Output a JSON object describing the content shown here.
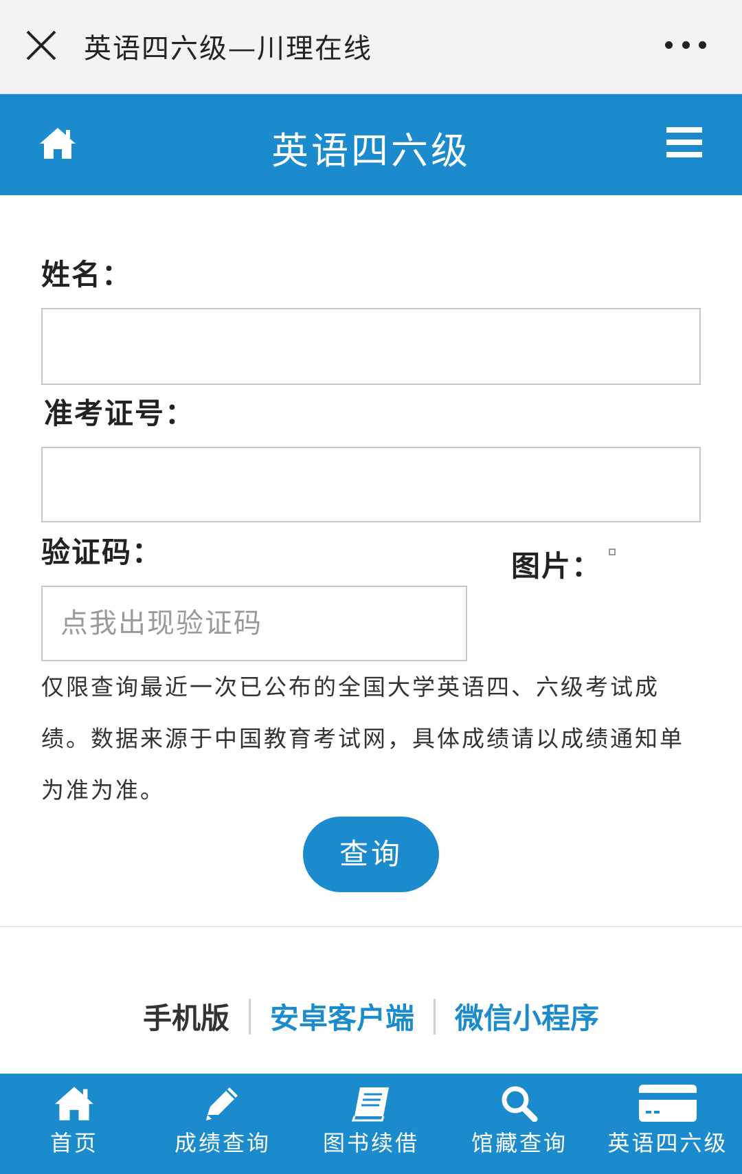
{
  "topbar": {
    "title": "英语四六级—川理在线"
  },
  "header": {
    "title": "英语四六级"
  },
  "form": {
    "name_label": "姓名：",
    "name_value": "",
    "ticket_label": "准考证号：",
    "ticket_value": "",
    "captcha_label": "验证码：",
    "captcha_placeholder": "点我出现验证码",
    "image_label": "图片："
  },
  "notice": "仅限查询最近一次已公布的全国大学英语四、六级考试成绩。数据来源于中国教育考试网，具体成绩请以成绩通知单为准为准。",
  "query_button": "查询",
  "versions": {
    "mobile": "手机版",
    "android": "安卓客户端",
    "miniprogram": "微信小程序"
  },
  "bottom_nav": [
    {
      "label": "首页",
      "icon": "home-icon"
    },
    {
      "label": "成绩查询",
      "icon": "pencil-icon"
    },
    {
      "label": "图书续借",
      "icon": "book-icon"
    },
    {
      "label": "馆藏查询",
      "icon": "search-icon"
    },
    {
      "label": "英语四六级",
      "icon": "card-icon"
    }
  ],
  "colors": {
    "brand": "#1b8bcd",
    "topbar": "#f3f3f3"
  }
}
